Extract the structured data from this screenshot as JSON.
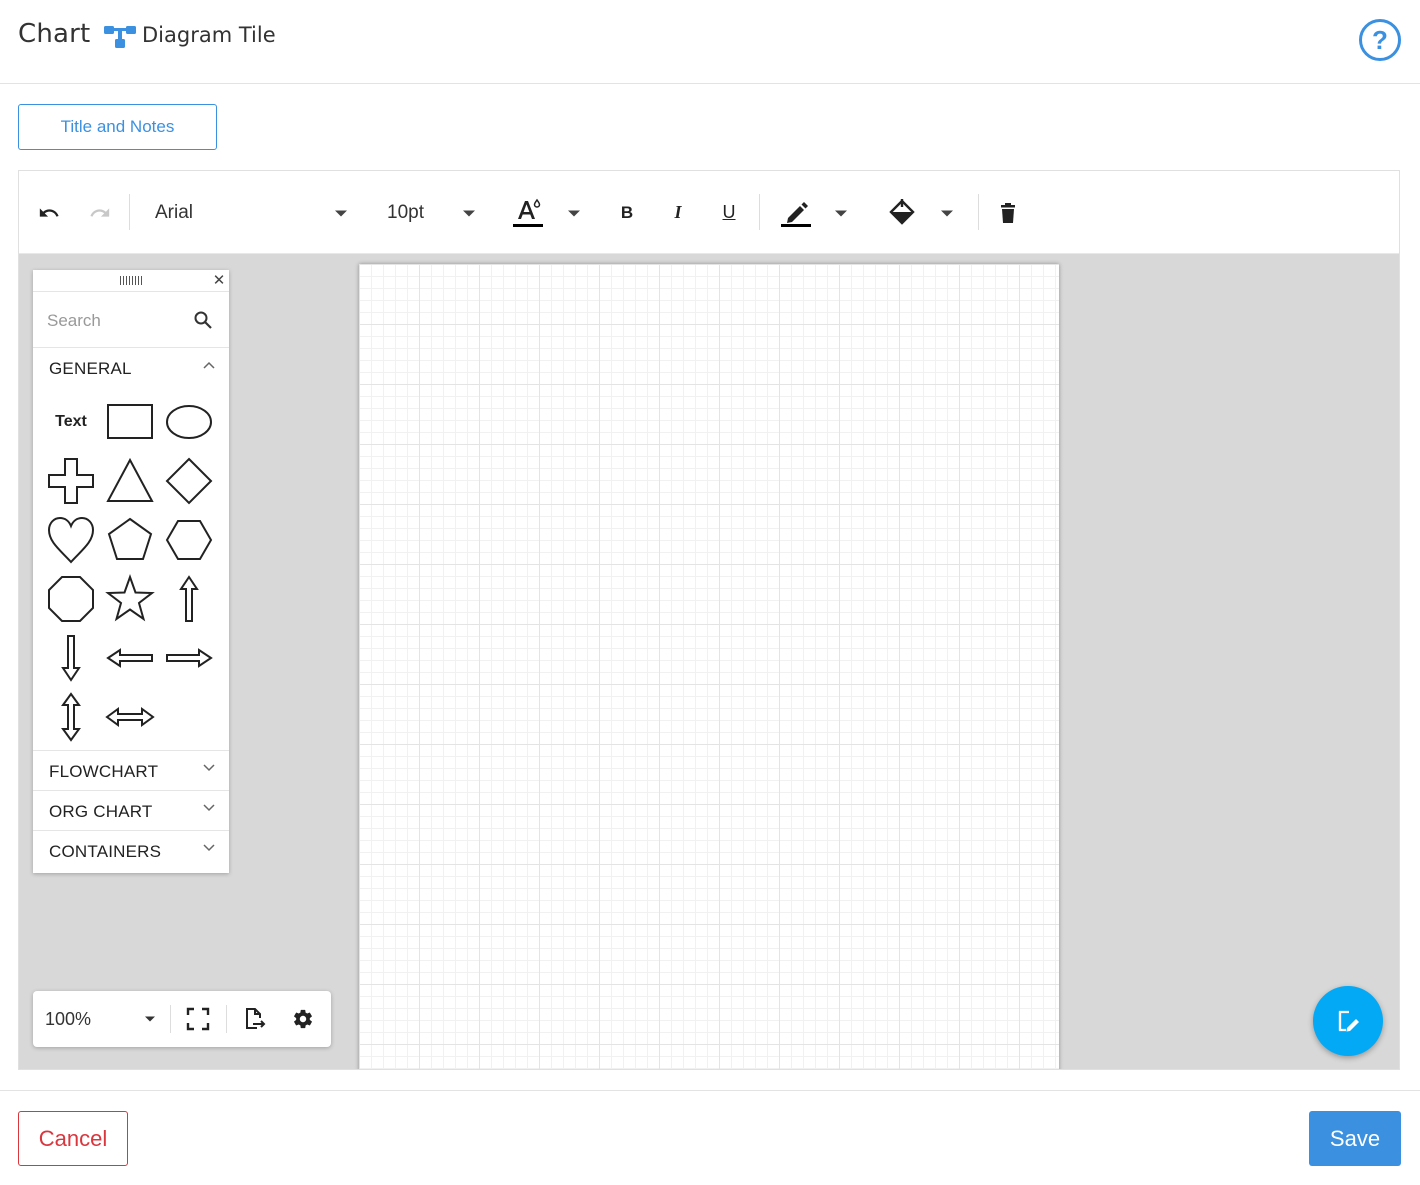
{
  "header": {
    "title": "Chart",
    "tile_label": "Diagram Tile",
    "help_label": "?"
  },
  "title_notes_label": "Title and Notes",
  "toolbar": {
    "font_family": "Arial",
    "font_size": "10pt",
    "bold_label": "B",
    "italic_label": "I",
    "underline_label": "U",
    "text_color": "#000000",
    "line_color": "#000000"
  },
  "palette": {
    "search_placeholder": "Search",
    "sections": {
      "general": "GENERAL",
      "flowchart": "FLOWCHART",
      "org_chart": "ORG CHART",
      "containers": "CONTAINERS"
    },
    "text_shape_label": "Text"
  },
  "zoom": {
    "level": "100%"
  },
  "footer": {
    "cancel_label": "Cancel",
    "save_label": "Save"
  },
  "colors": {
    "accent": "#3b91e0",
    "danger": "#d9363e",
    "fab": "#03a9f4",
    "canvas_bg": "#d8d8d8"
  }
}
